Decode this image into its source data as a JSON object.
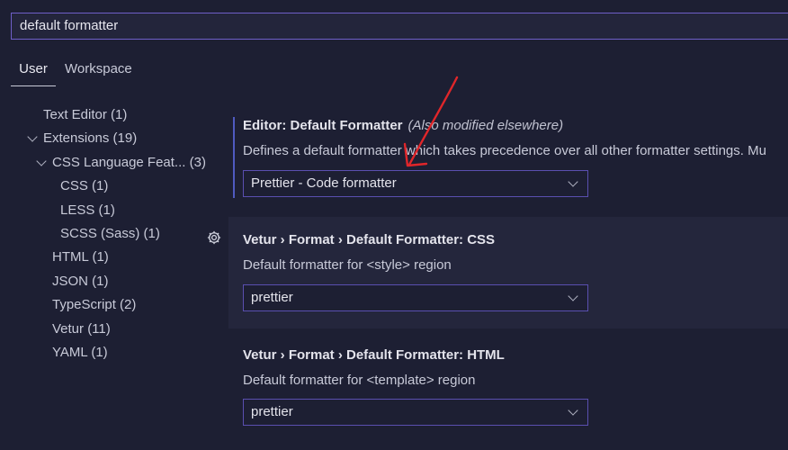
{
  "search": {
    "value": "default formatter"
  },
  "tabs": [
    {
      "label": "User"
    },
    {
      "label": "Workspace"
    }
  ],
  "tree": [
    {
      "label": "Text Editor (1)"
    },
    {
      "label": "Extensions (19)"
    },
    {
      "label": "CSS Language Feat... (3)"
    },
    {
      "label": "CSS (1)"
    },
    {
      "label": "LESS (1)"
    },
    {
      "label": "SCSS (Sass) (1)"
    },
    {
      "label": "HTML (1)"
    },
    {
      "label": "JSON (1)"
    },
    {
      "label": "TypeScript (2)"
    },
    {
      "label": "Vetur (11)"
    },
    {
      "label": "YAML (1)"
    }
  ],
  "settings": [
    {
      "title": "Editor: Default Formatter",
      "modified": "(Also modified elsewhere)",
      "description": "Defines a default formatter which takes precedence over all other formatter settings. Mu",
      "value": "Prettier - Code formatter"
    },
    {
      "title": "Vetur › Format › Default Formatter: CSS",
      "description": "Default formatter for <style> region",
      "value": "prettier"
    },
    {
      "title": "Vetur › Format › Default Formatter: HTML",
      "description": "Default formatter for <template> region",
      "value": "prettier"
    }
  ],
  "icons": {
    "gear": "gear-icon",
    "chevron": "chevron-down-icon"
  },
  "colors": {
    "accent": "#6e5fc8",
    "annotation": "#e0262a",
    "background": "#1d1f33"
  }
}
